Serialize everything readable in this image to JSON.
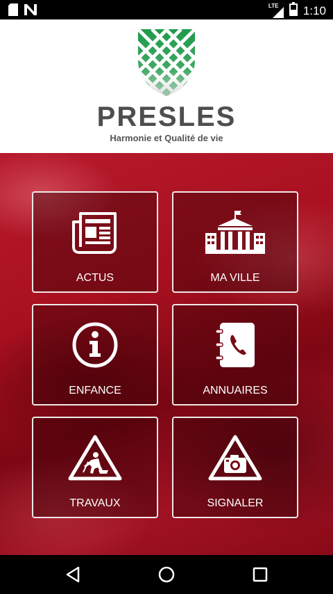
{
  "status_bar": {
    "time": "1:10",
    "network": "LTE",
    "left_icons": [
      "sd-card-icon",
      "n-notification-icon"
    ]
  },
  "header": {
    "town_name": "PRESLES",
    "tagline": "Harmonie et Qualité de vie"
  },
  "menu": {
    "actus": {
      "label": "ACTUS",
      "icon": "newspaper-icon"
    },
    "ma_ville": {
      "label": "MA VILLE",
      "icon": "town-hall-icon"
    },
    "enfance": {
      "label": "ENFANCE",
      "icon": "info-icon"
    },
    "annuaires": {
      "label": "ANNUAIRES",
      "icon": "phonebook-icon"
    },
    "travaux": {
      "label": "TRAVAUX",
      "icon": "roadworks-icon"
    },
    "signaler": {
      "label": "SIGNALER",
      "icon": "camera-warning-icon"
    }
  },
  "nav_bar": {
    "back": "back-icon",
    "home": "home-icon",
    "recents": "recents-icon"
  },
  "colors": {
    "header_bg": "#ffffff",
    "brand_text": "#4e4e4e",
    "crest_green": "#1f9a4b",
    "background_red": "#a8101f"
  }
}
